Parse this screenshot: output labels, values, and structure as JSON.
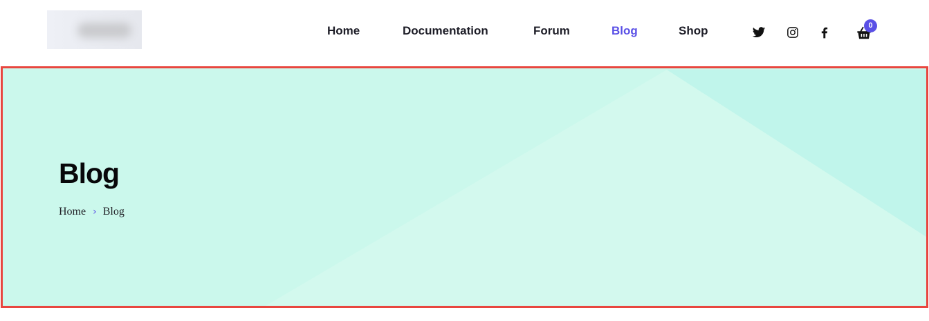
{
  "header": {
    "logo_icon": "logo-blurred",
    "nav": [
      {
        "label": "Home",
        "active": false
      },
      {
        "label": "Documentation",
        "active": false
      },
      {
        "label": "Forum",
        "active": false
      },
      {
        "label": "Blog",
        "active": true
      },
      {
        "label": "Shop",
        "active": false
      }
    ],
    "social": [
      {
        "icon": "twitter-icon"
      },
      {
        "icon": "instagram-icon"
      },
      {
        "icon": "facebook-icon"
      }
    ],
    "cart": {
      "icon": "basket-icon",
      "count": "0"
    }
  },
  "hero": {
    "title": "Blog",
    "breadcrumb": {
      "home": "Home",
      "separator_icon": "chevron-right-icon",
      "current": "Blog"
    }
  },
  "colors": {
    "accent": "#5a50e6",
    "hero_bg": "#cbf8ec",
    "hero_border": "#e8463f",
    "text_dark": "#1d1d27"
  }
}
